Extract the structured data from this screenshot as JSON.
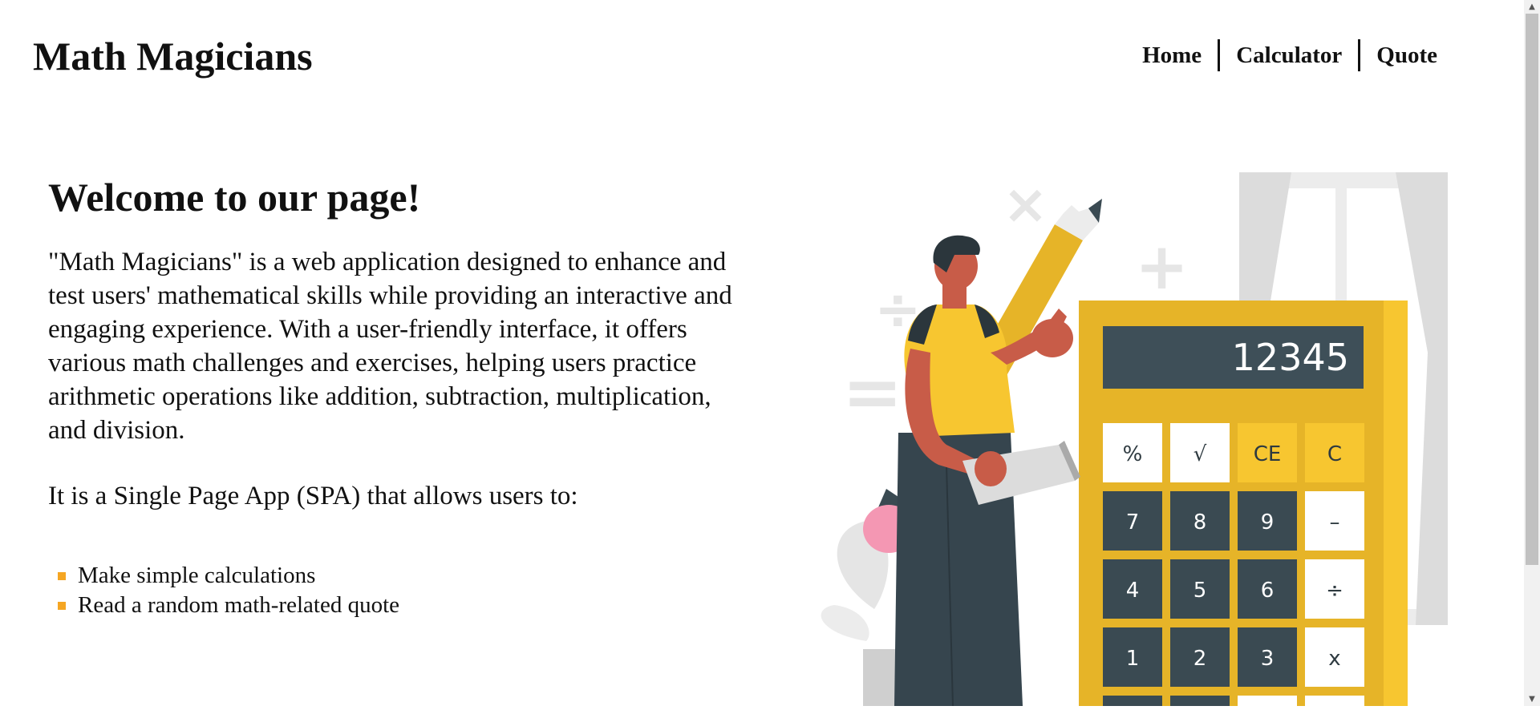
{
  "header": {
    "logo": "Math Magicians",
    "nav": [
      "Home",
      "Calculator",
      "Quote"
    ]
  },
  "main": {
    "heading": "Welcome to our page!",
    "description": "\"Math Magicians\" is a web application designed to enhance and test users' mathematical skills while providing an interactive and engaging experience. With a user-friendly interface, it offers various math challenges and exercises, helping users practice arithmetic operations like addition, subtraction, multiplication, and division.",
    "spa_text": "It is a Single Page App (SPA) that allows users to:",
    "features": [
      "Make simple calculations",
      "Read a random math-related quote"
    ]
  },
  "illustration": {
    "display": "12345",
    "keys_row1": [
      "%",
      "√",
      "CE",
      "C"
    ],
    "keys_row2": [
      "7",
      "8",
      "9",
      "–"
    ],
    "keys_row3": [
      "4",
      "5",
      "6",
      "÷"
    ],
    "keys_row4": [
      "1",
      "2",
      "3",
      "x"
    ],
    "symbols": [
      "×",
      "+",
      "÷",
      "="
    ]
  },
  "colors": {
    "accent": "#f5a623",
    "calculator_yellow": "#f7c630",
    "calculator_dark": "#3a4a52",
    "skin": "#c85c48"
  }
}
